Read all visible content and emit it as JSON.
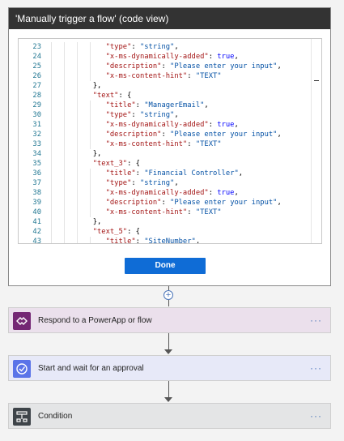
{
  "card": {
    "title": "'Manually trigger a flow' (code view)",
    "done_label": "Done"
  },
  "code_lines": [
    {
      "n": "23",
      "indent": 4,
      "parts": [
        [
          "k",
          "\"type\""
        ],
        [
          "p",
          ": "
        ],
        [
          "s",
          "\"string\""
        ],
        [
          "p",
          ","
        ]
      ]
    },
    {
      "n": "24",
      "indent": 4,
      "parts": [
        [
          "k",
          "\"x-ms-dynamically-added\""
        ],
        [
          "p",
          ": "
        ],
        [
          "kw",
          "true"
        ],
        [
          "p",
          ","
        ]
      ]
    },
    {
      "n": "25",
      "indent": 4,
      "parts": [
        [
          "k",
          "\"description\""
        ],
        [
          "p",
          ": "
        ],
        [
          "s",
          "\"Please enter your input\""
        ],
        [
          "p",
          ","
        ]
      ]
    },
    {
      "n": "26",
      "indent": 4,
      "parts": [
        [
          "k",
          "\"x-ms-content-hint\""
        ],
        [
          "p",
          ": "
        ],
        [
          "s",
          "\"TEXT\""
        ]
      ]
    },
    {
      "n": "27",
      "indent": 3,
      "parts": [
        [
          "p",
          "},"
        ]
      ]
    },
    {
      "n": "28",
      "indent": 3,
      "parts": [
        [
          "k",
          "\"text\""
        ],
        [
          "p",
          ": {"
        ]
      ]
    },
    {
      "n": "29",
      "indent": 4,
      "parts": [
        [
          "k",
          "\"title\""
        ],
        [
          "p",
          ": "
        ],
        [
          "s",
          "\"ManagerEmail\""
        ],
        [
          "p",
          ","
        ]
      ]
    },
    {
      "n": "30",
      "indent": 4,
      "parts": [
        [
          "k",
          "\"type\""
        ],
        [
          "p",
          ": "
        ],
        [
          "s",
          "\"string\""
        ],
        [
          "p",
          ","
        ]
      ]
    },
    {
      "n": "31",
      "indent": 4,
      "parts": [
        [
          "k",
          "\"x-ms-dynamically-added\""
        ],
        [
          "p",
          ": "
        ],
        [
          "kw",
          "true"
        ],
        [
          "p",
          ","
        ]
      ]
    },
    {
      "n": "32",
      "indent": 4,
      "parts": [
        [
          "k",
          "\"description\""
        ],
        [
          "p",
          ": "
        ],
        [
          "s",
          "\"Please enter your input\""
        ],
        [
          "p",
          ","
        ]
      ]
    },
    {
      "n": "33",
      "indent": 4,
      "parts": [
        [
          "k",
          "\"x-ms-content-hint\""
        ],
        [
          "p",
          ": "
        ],
        [
          "s",
          "\"TEXT\""
        ]
      ]
    },
    {
      "n": "34",
      "indent": 3,
      "parts": [
        [
          "p",
          "},"
        ]
      ]
    },
    {
      "n": "35",
      "indent": 3,
      "parts": [
        [
          "k",
          "\"text_3\""
        ],
        [
          "p",
          ": {"
        ]
      ]
    },
    {
      "n": "36",
      "indent": 4,
      "parts": [
        [
          "k",
          "\"title\""
        ],
        [
          "p",
          ": "
        ],
        [
          "s",
          "\"Financial Controller\""
        ],
        [
          "p",
          ","
        ]
      ]
    },
    {
      "n": "37",
      "indent": 4,
      "parts": [
        [
          "k",
          "\"type\""
        ],
        [
          "p",
          ": "
        ],
        [
          "s",
          "\"string\""
        ],
        [
          "p",
          ","
        ]
      ]
    },
    {
      "n": "38",
      "indent": 4,
      "parts": [
        [
          "k",
          "\"x-ms-dynamically-added\""
        ],
        [
          "p",
          ": "
        ],
        [
          "kw",
          "true"
        ],
        [
          "p",
          ","
        ]
      ]
    },
    {
      "n": "39",
      "indent": 4,
      "parts": [
        [
          "k",
          "\"description\""
        ],
        [
          "p",
          ": "
        ],
        [
          "s",
          "\"Please enter your input\""
        ],
        [
          "p",
          ","
        ]
      ]
    },
    {
      "n": "40",
      "indent": 4,
      "parts": [
        [
          "k",
          "\"x-ms-content-hint\""
        ],
        [
          "p",
          ": "
        ],
        [
          "s",
          "\"TEXT\""
        ]
      ]
    },
    {
      "n": "41",
      "indent": 3,
      "parts": [
        [
          "p",
          "},"
        ]
      ]
    },
    {
      "n": "42",
      "indent": 3,
      "parts": [
        [
          "k",
          "\"text_5\""
        ],
        [
          "p",
          ": {"
        ]
      ]
    },
    {
      "n": "43",
      "indent": 4,
      "parts": [
        [
          "k",
          "\"title\""
        ],
        [
          "p",
          ": "
        ],
        [
          "s",
          "\"SiteNumber\""
        ],
        [
          "p",
          ","
        ]
      ]
    }
  ],
  "steps": [
    {
      "label": "Respond to a PowerApp or flow",
      "more": "···",
      "bg": "#ebe0ec",
      "icon_bg": "#742774",
      "icon": "powerapps-icon"
    },
    {
      "label": "Start and wait for an approval",
      "more": "···",
      "bg": "#e7e9f8",
      "icon_bg": "#5b74e8",
      "icon": "approval-icon"
    },
    {
      "label": "Condition",
      "more": "···",
      "bg": "#e4e5e6",
      "icon_bg": "#3e4449",
      "icon": "condition-icon"
    }
  ],
  "insert_step_symbol": "+"
}
